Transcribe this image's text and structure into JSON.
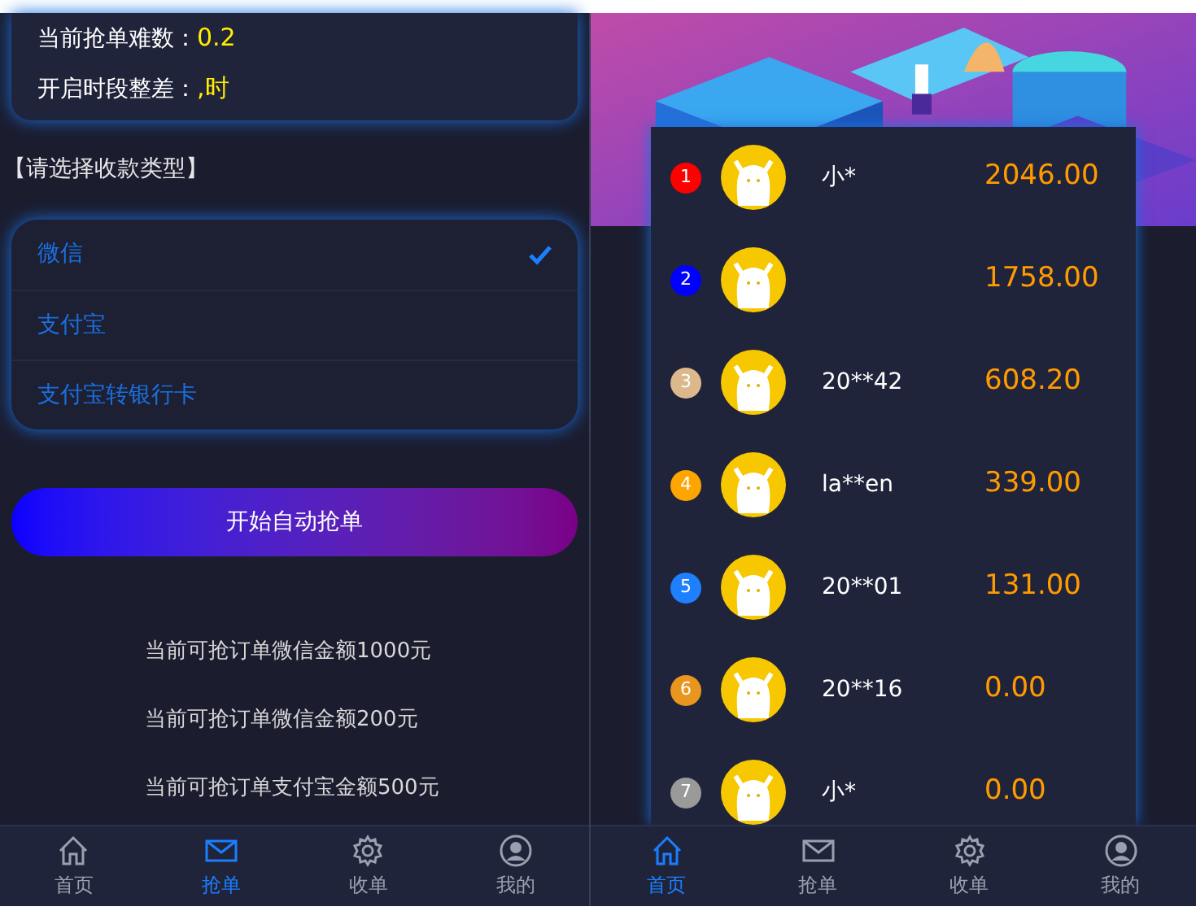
{
  "left_screen": {
    "info": [
      {
        "label": "当前抢单难数：",
        "value": "0.2"
      },
      {
        "label": "开启时段整差：",
        "value": ",时"
      }
    ],
    "payment_prompt": "【请选择收款类型】",
    "payment_options": [
      {
        "label": "微信",
        "selected": true
      },
      {
        "label": "支付宝",
        "selected": false
      },
      {
        "label": "支付宝转银行卡",
        "selected": false
      }
    ],
    "start_button": "开始自动抢单",
    "notices": [
      "当前可抢订单微信金额1000元",
      "当前可抢订单微信金额200元",
      "当前可抢订单支付宝金额500元"
    ],
    "nav": [
      {
        "label": "首页",
        "selected": false
      },
      {
        "label": "抢单",
        "selected": true
      },
      {
        "label": "收单",
        "selected": false
      },
      {
        "label": "我的",
        "selected": false
      }
    ]
  },
  "right_screen": {
    "ranking": [
      {
        "rank": "1",
        "color": "#ff0000",
        "name": "小*",
        "amount": "2046.00"
      },
      {
        "rank": "2",
        "color": "#0000ff",
        "amount": "1758.00"
      },
      {
        "rank": "3",
        "color": "#dcb98c",
        "name": "20**42",
        "amount": "608.20"
      },
      {
        "rank": "4",
        "color": "#ffa500",
        "name": "la**en",
        "amount": "339.00"
      },
      {
        "rank": "5",
        "color": "#1e7fff",
        "name": "20**01",
        "amount": "131.00"
      },
      {
        "rank": "6",
        "color": "#e8961e",
        "name": "20**16",
        "amount": "0.00"
      },
      {
        "rank": "7",
        "color": "#9a9a9a",
        "name": "小*",
        "amount": "0.00"
      }
    ],
    "nav": [
      {
        "label": "首页",
        "selected": true
      },
      {
        "label": "抢单",
        "selected": false
      },
      {
        "label": "收单",
        "selected": false
      },
      {
        "label": "我的",
        "selected": false
      }
    ]
  }
}
